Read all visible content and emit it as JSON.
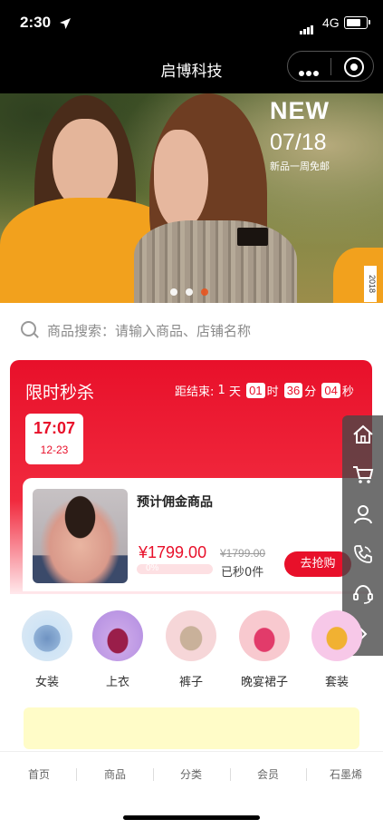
{
  "status_bar": {
    "time": "2:30",
    "network": "4G"
  },
  "app": {
    "title": "启博科技"
  },
  "banner": {
    "headline": "NEW",
    "date": "07/18",
    "subtitle": "新品一周免邮",
    "year_tag": "2018",
    "slide_count": 3,
    "active_slide": 3
  },
  "search": {
    "placeholder": "商品搜索：请输入商品、店铺名称"
  },
  "flash_sale": {
    "title": "限时秒杀",
    "countdown_prefix": "距结束:",
    "days": "1",
    "days_unit": "天",
    "hours": "01",
    "hours_unit": "时",
    "minutes": "36",
    "minutes_unit": "分",
    "seconds": "04",
    "seconds_unit": "秒",
    "slot_time": "17:07",
    "slot_date": "12-23",
    "product": {
      "name": "预计佣金商品",
      "price": "¥1799.00",
      "original_price": "¥1799.00",
      "progress_label": "0%",
      "progress": 0,
      "sold": "已秒0件",
      "buy_label": "去抢购"
    }
  },
  "sidebar": {
    "items": [
      {
        "icon": "home-icon"
      },
      {
        "icon": "cart-icon"
      },
      {
        "icon": "user-icon"
      },
      {
        "icon": "phone-icon"
      },
      {
        "icon": "support-icon"
      },
      {
        "icon": "chevron-right-icon"
      }
    ]
  },
  "categories": [
    {
      "label": "女装",
      "color": "#cfe4f5"
    },
    {
      "label": "上衣",
      "color": "#c8a4e8"
    },
    {
      "label": "裤子",
      "color": "#f6d6d8"
    },
    {
      "label": "晚宴裙子",
      "color": "#f8c9cf"
    },
    {
      "label": "套装",
      "color": "#f7c8e8"
    }
  ],
  "bottom_nav": [
    {
      "label": "首页"
    },
    {
      "label": "商品"
    },
    {
      "label": "分类"
    },
    {
      "label": "会员"
    },
    {
      "label": "石墨烯"
    }
  ],
  "colors": {
    "accent": "#e8102a",
    "notice_bg": "#fffcc8"
  }
}
